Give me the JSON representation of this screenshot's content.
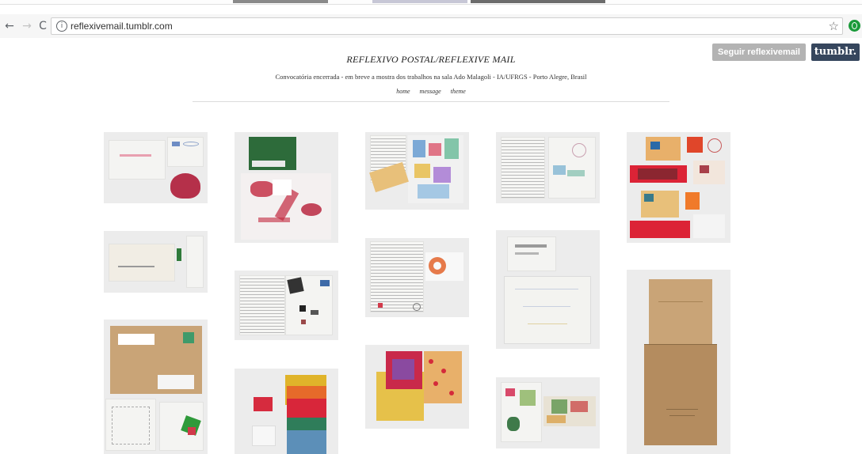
{
  "browser": {
    "url": "reflexivemail.tumblr.com",
    "back_icon": "←",
    "forward_icon": "→",
    "reload_icon": "C",
    "info_icon": "i",
    "star_icon": "☆"
  },
  "tumblr_controls": {
    "follow_label": "Seguir reflexivemail",
    "logo_label": "tumblr."
  },
  "blog": {
    "title": "REFLEXIVO POSTAL/REFLEXIVE MAIL",
    "description": "Convocatória encerrada - em breve a mostra dos trabalhos na sala Ado Malagoli - IA/UFRGS - Porto Alegre, Brasil",
    "nav": [
      "home",
      "message",
      "theme"
    ]
  },
  "colors": {
    "follow_button": "#b3b3b3",
    "tumblr_button": "#36465d",
    "page_background": "#ffffff",
    "photo_background": "#ececec"
  }
}
